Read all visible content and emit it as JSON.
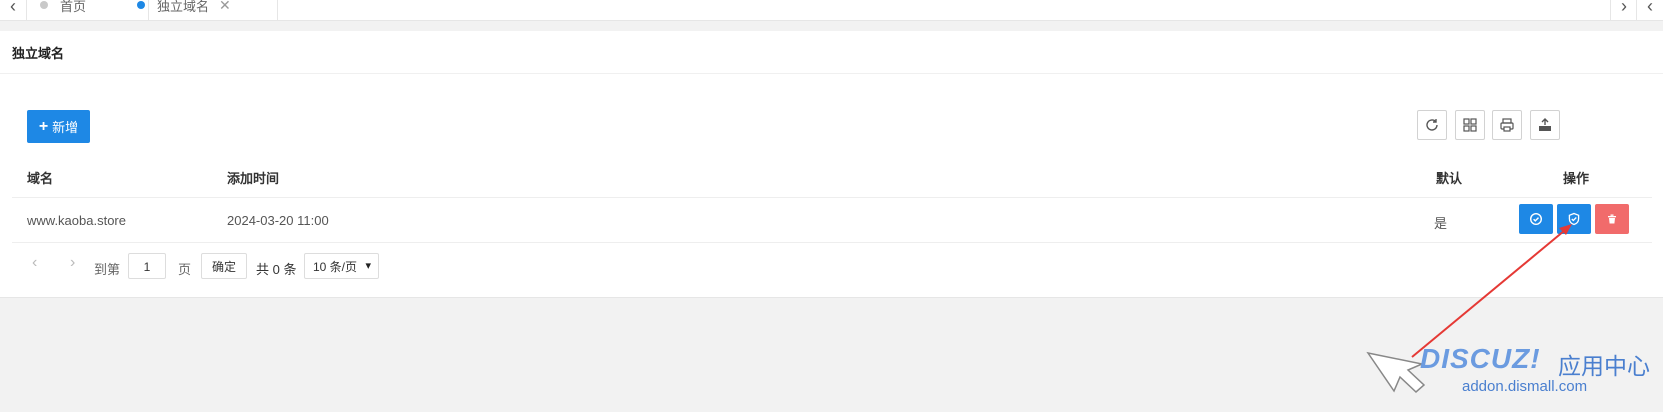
{
  "tabs": {
    "home_label": "首页",
    "current_label": "独立域名",
    "close_glyph": "✕"
  },
  "panel": {
    "title": "独立域名",
    "add_button_label": "新增"
  },
  "table": {
    "headers": {
      "domain": "域名",
      "added_time": "添加时间",
      "default": "默认",
      "actions": "操作"
    },
    "rows": [
      {
        "domain": "www.kaoba.store",
        "added_time": "2024-03-20 11:00",
        "default": "是"
      }
    ]
  },
  "pagination": {
    "goto_label": "到第",
    "page_value": "1",
    "page_unit": "页",
    "confirm_label": "确定",
    "total_text": "共 0 条",
    "page_size_selected": "10 条/页"
  },
  "watermark": {
    "logo_text": "DISCUZ!",
    "cn_text": "应用中心",
    "url_text": "addon.dismall.com"
  },
  "colors": {
    "primary": "#1e88e5",
    "danger": "#f16b6b",
    "annotation_arrow": "#e53935"
  },
  "icons": {
    "tab_prev": "chevron-left-icon",
    "tab_next": "chevron-right-icon",
    "refresh": "refresh-icon",
    "columns": "columns-grid-icon",
    "print": "print-icon",
    "export": "export-icon",
    "set_default": "check-circle-icon",
    "verify": "shield-check-icon",
    "delete": "trash-icon"
  }
}
